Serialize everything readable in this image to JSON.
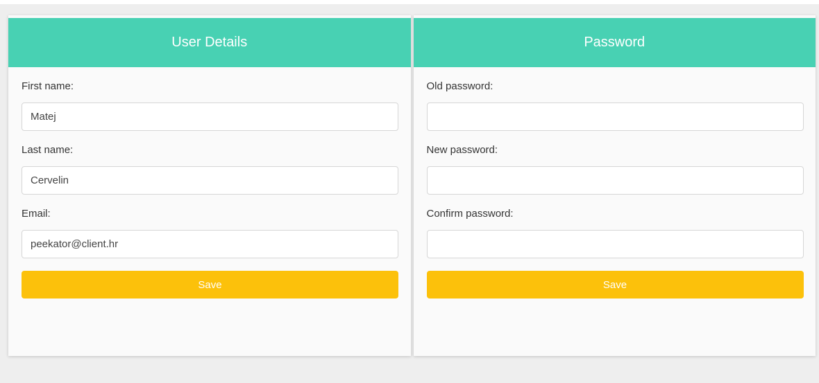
{
  "user_details": {
    "title": "User Details",
    "first_name_label": "First name:",
    "first_name_value": "Matej",
    "last_name_label": "Last name:",
    "last_name_value": "Cervelin",
    "email_label": "Email:",
    "email_value": "peekator@client.hr",
    "save_label": "Save"
  },
  "password": {
    "title": "Password",
    "old_label": "Old password:",
    "old_value": "",
    "new_label": "New password:",
    "new_value": "",
    "confirm_label": "Confirm password:",
    "confirm_value": "",
    "save_label": "Save"
  },
  "colors": {
    "header": "#48d1b3",
    "button": "#fcc10b",
    "background": "#eeeeee",
    "panel": "#fafafa"
  }
}
